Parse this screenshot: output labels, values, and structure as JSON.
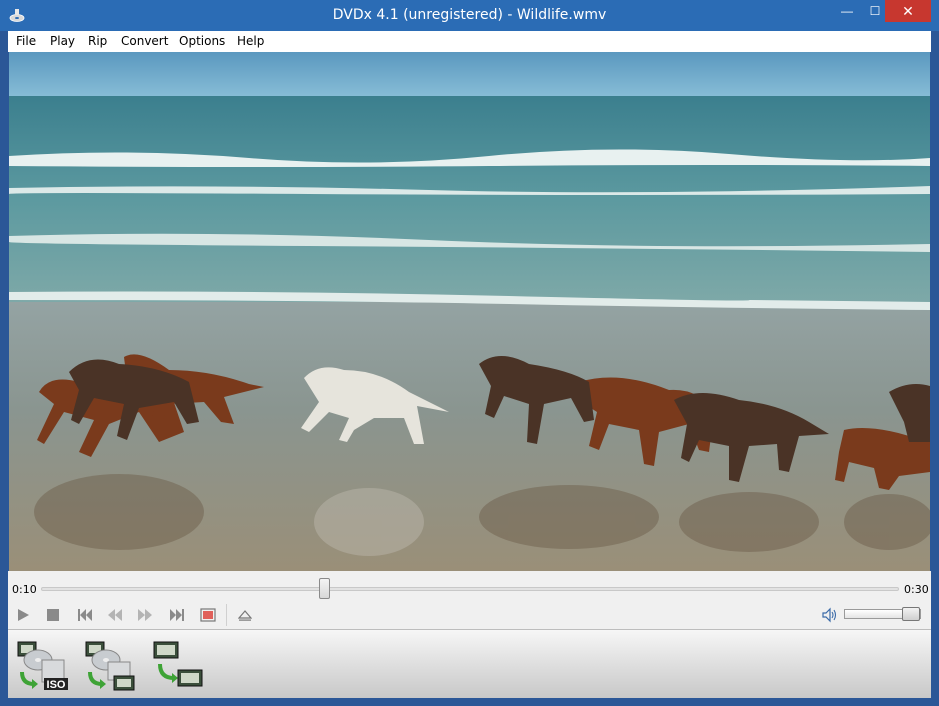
{
  "window": {
    "title": "DVDx 4.1 (unregistered) - Wildlife.wmv",
    "minimize_glyph": "—",
    "maximize_glyph": "☐",
    "close_glyph": "✕"
  },
  "menu": [
    {
      "label": "File"
    },
    {
      "label": "Play"
    },
    {
      "label": "Rip"
    },
    {
      "label": "Convert"
    },
    {
      "label": "Options"
    },
    {
      "label": "Help"
    }
  ],
  "player": {
    "current_time": "0:10",
    "total_time": "0:30",
    "progress": 0.33,
    "volume": 1.0
  },
  "transport_icons": [
    "play-icon",
    "stop-icon",
    "skip-previous-icon",
    "rewind-icon",
    "fast-forward-icon",
    "skip-next-icon",
    "fullscreen-icon",
    "eject-icon",
    "speaker-icon"
  ],
  "actions": {
    "iso_badge": "ISO",
    "icons": [
      "disc-to-iso-icon",
      "disc-to-video-icon",
      "video-to-video-icon"
    ]
  },
  "colors": {
    "titlebar": "#2b6cb5",
    "close_button": "#c7372f",
    "window_frame": "#2b5797"
  }
}
